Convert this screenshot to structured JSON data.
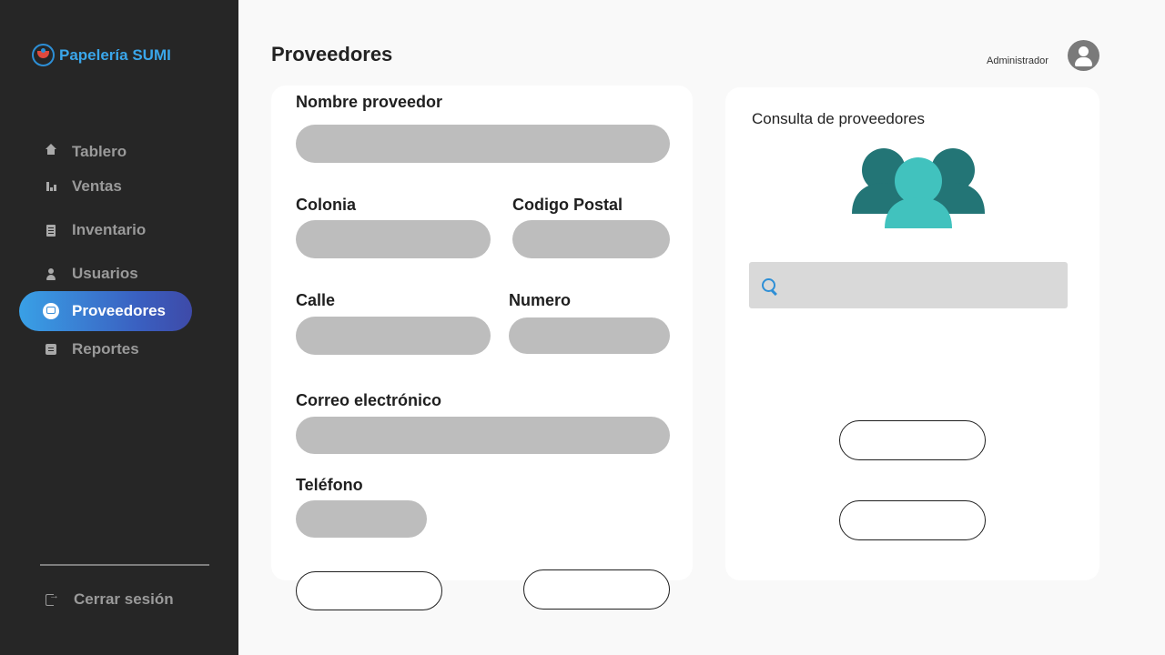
{
  "app": {
    "name": "Papelería SUMI"
  },
  "sidebar": {
    "items": [
      {
        "label": "Tablero",
        "icon": "home-icon"
      },
      {
        "label": "Ventas",
        "icon": "bar-chart-icon"
      },
      {
        "label": "Inventario",
        "icon": "document-icon"
      },
      {
        "label": "Usuarios",
        "icon": "user-icon"
      },
      {
        "label": "Proveedores",
        "icon": "globe-icon",
        "active": true
      },
      {
        "label": "Reportes",
        "icon": "report-icon"
      }
    ],
    "logout_label": "Cerrar sesión",
    "active_gradient": [
      "#39a0e6",
      "#3e4aa8"
    ]
  },
  "header": {
    "title": "Proveedores",
    "user_role": "Administrador"
  },
  "form": {
    "nombre_label": "Nombre proveedor",
    "colonia_label": "Colonia",
    "codigo_postal_label": "Codigo Postal",
    "calle_label": "Calle",
    "numero_label": "Numero",
    "correo_label": "Correo electrónico",
    "telefono_label": "Teléfono",
    "nombre_value": "",
    "colonia_value": "",
    "codigo_postal_value": "",
    "calle_value": "",
    "numero_value": "",
    "correo_value": "",
    "telefono_value": ""
  },
  "consulta": {
    "title": "Consulta de proveedores",
    "search_value": "",
    "group_icon": "suppliers-group-icon"
  },
  "colors": {
    "sidebar_bg": "#262626",
    "accent_blue": "#3aa6ea",
    "group_dark": "#237576",
    "group_light": "#41c2be",
    "field_bg": "#bdbdbd"
  }
}
